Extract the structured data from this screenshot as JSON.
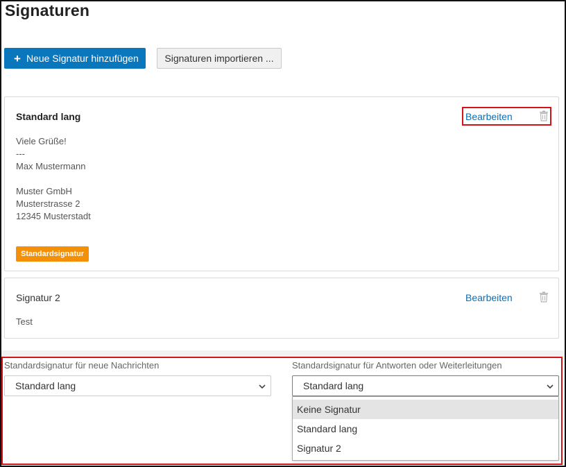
{
  "page": {
    "title": "Signaturen"
  },
  "toolbar": {
    "add_icon": "plus-icon",
    "add_label": "Neue Signatur hinzufügen",
    "import_label": "Signaturen importieren ..."
  },
  "signatures": [
    {
      "name": "Standard lang",
      "edit_label": "Bearbeiten",
      "delete_icon": "trash-icon",
      "lines": [
        "Viele Grüße!",
        "---",
        "Max Mustermann",
        "",
        "Muster GmbH",
        "Musterstrasse 2",
        "12345 Musterstadt"
      ],
      "badge": "Standardsignatur"
    },
    {
      "name": "Signatur 2",
      "edit_label": "Bearbeiten",
      "delete_icon": "trash-icon",
      "lines": [
        "Test"
      ]
    }
  ],
  "defaults": {
    "new_messages": {
      "label": "Standardsignatur für neue Nachrichten",
      "value": "Standard lang"
    },
    "replies": {
      "label": "Standardsignatur für Antworten oder Weiterleitungen",
      "value": "Standard lang",
      "options": [
        "Keine Signatur",
        "Standard lang",
        "Signatur 2"
      ],
      "highlighted_option": "Keine Signatur"
    }
  },
  "colors": {
    "primary": "#0a76bc",
    "link": "#0a6fb5",
    "badge": "#f39008",
    "highlight_border": "#d1141c"
  }
}
